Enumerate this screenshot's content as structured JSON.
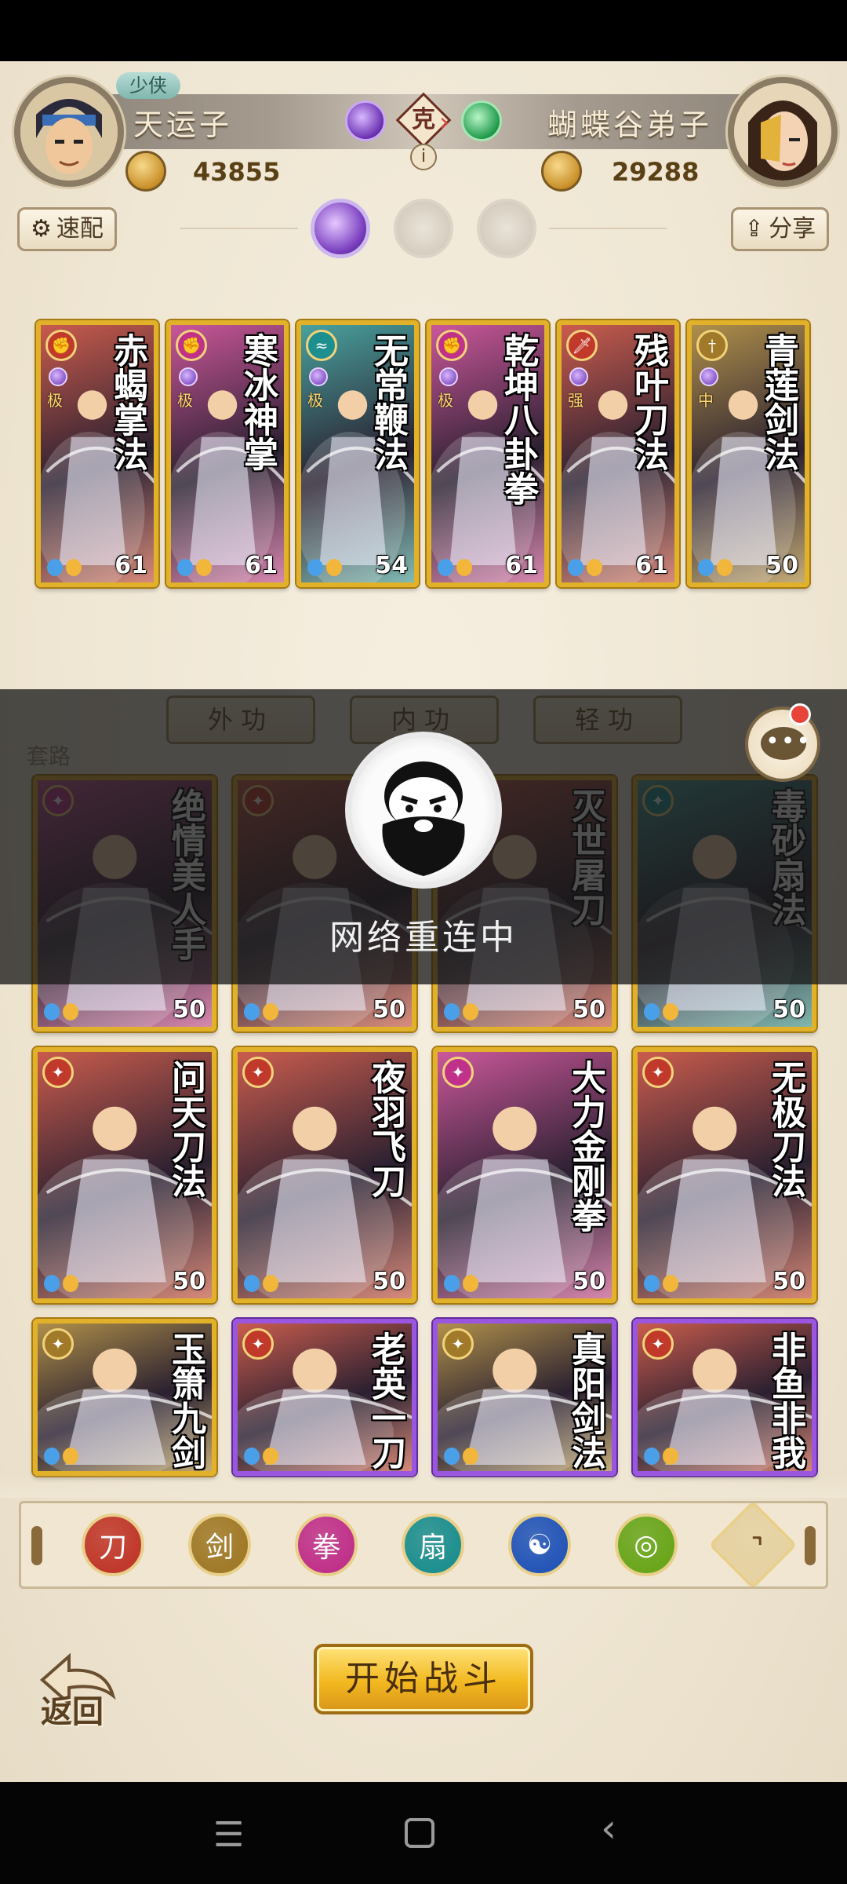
{
  "player": {
    "rank": "少侠",
    "name": "天运子",
    "power": "43855"
  },
  "opponent": {
    "name": "蝴蝶谷弟子",
    "power": "29288"
  },
  "versus": {
    "tag": "克",
    "info": "i"
  },
  "buttons": {
    "quick_config": "速配",
    "share": "分享",
    "start_battle": "开始战斗",
    "back": "返回"
  },
  "equipped_cards": [
    {
      "title": "赤蝎掌法",
      "level": "61",
      "grade": "极",
      "element": "fist",
      "color": "#c0392b"
    },
    {
      "title": "寒冰神掌",
      "level": "61",
      "grade": "极",
      "element": "fist",
      "color": "#c0328a"
    },
    {
      "title": "无常鞭法",
      "level": "54",
      "grade": "极",
      "element": "whip",
      "color": "#1e8f8f"
    },
    {
      "title": "乾坤八卦拳",
      "level": "61",
      "grade": "极",
      "element": "fist",
      "color": "#c0328a"
    },
    {
      "title": "残叶刀法",
      "level": "61",
      "grade": "强",
      "element": "blade",
      "color": "#c0392b"
    },
    {
      "title": "青莲剑法",
      "level": "50",
      "grade": "中",
      "element": "sword",
      "color": "#a07a28"
    }
  ],
  "tabs": [
    "外功",
    "内功",
    "轻功"
  ],
  "taolu": "套路",
  "overlay": {
    "text": "网络重连中"
  },
  "pool_cards": [
    {
      "title": "绝情美人手",
      "level": "50",
      "color": "#c0328a",
      "frame": "gold"
    },
    {
      "title": "",
      "level": "50",
      "color": "#c0392b",
      "frame": "gold"
    },
    {
      "title": "灭世屠刀",
      "level": "50",
      "color": "#c0392b",
      "frame": "gold"
    },
    {
      "title": "毒砂扇法",
      "level": "50",
      "color": "#1e8f8f",
      "frame": "gold"
    },
    {
      "title": "问天刀法",
      "level": "50",
      "color": "#c0392b",
      "frame": "gold"
    },
    {
      "title": "夜羽飞刀",
      "level": "50",
      "color": "#c0392b",
      "frame": "gold"
    },
    {
      "title": "大力金刚拳",
      "level": "50",
      "color": "#c0328a",
      "frame": "gold"
    },
    {
      "title": "无极刀法",
      "level": "50",
      "color": "#c0392b",
      "frame": "gold"
    },
    {
      "title": "玉箫九剑",
      "level": "",
      "color": "#a07a28",
      "frame": "gold"
    },
    {
      "title": "老英一刀",
      "level": "",
      "color": "#c0392b",
      "frame": "purple"
    },
    {
      "title": "真阳剑法",
      "level": "",
      "color": "#a07a28",
      "frame": "purple"
    },
    {
      "title": "非鱼非我",
      "level": "",
      "color": "#c0392b",
      "frame": "purple"
    }
  ],
  "filters": [
    {
      "name": "blade",
      "color": "#c0392b",
      "glyph": "刀"
    },
    {
      "name": "sword",
      "color": "#a07a28",
      "glyph": "剑"
    },
    {
      "name": "fist",
      "color": "#c0328a",
      "glyph": "拳"
    },
    {
      "name": "fan",
      "color": "#1e8f8f",
      "glyph": "扇"
    },
    {
      "name": "taiji",
      "color": "#2456b8",
      "glyph": "☯"
    },
    {
      "name": "spin",
      "color": "#6aa61c",
      "glyph": "◎"
    },
    {
      "name": "up",
      "color": "#e6d2a2",
      "glyph": "⌃"
    }
  ]
}
